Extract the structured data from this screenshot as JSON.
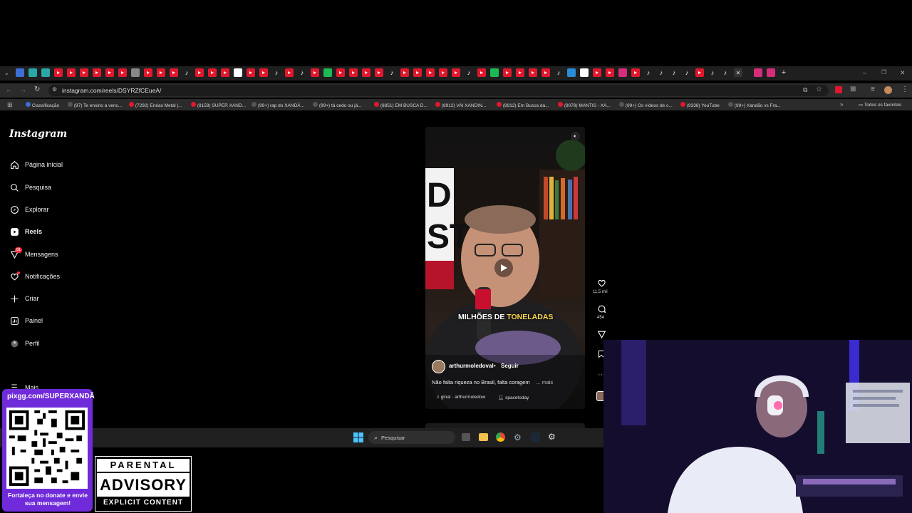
{
  "browser": {
    "url": "instagram.com/reels/DSYRZfCEueA/",
    "bookmarks": [
      {
        "label": "Classificação",
        "color": "#3b6fd6"
      },
      {
        "label": "(97) Te ensino a venc...",
        "color": "#111"
      },
      {
        "label": "(7292) Enéas Metal |...",
        "color": "#e0182d"
      },
      {
        "label": "(8159) SUPER XAND...",
        "color": "#e0182d"
      },
      {
        "label": "(99+) rap do XANDÃ...",
        "color": "#111"
      },
      {
        "label": "(99+) tá cedo ou já...",
        "color": "#111"
      },
      {
        "label": "(8851) EM BUSCA D...",
        "color": "#e0182d"
      },
      {
        "label": "(8912) VAI XANDIN...",
        "color": "#e0182d"
      },
      {
        "label": "(8912) Em Busca da...",
        "color": "#e0182d"
      },
      {
        "label": "(9078) MANTIS - XA...",
        "color": "#e0182d"
      },
      {
        "label": "(99+) Os vídeos de c...",
        "color": "#111"
      },
      {
        "label": "(9338) YouTube",
        "color": "#e0182d"
      },
      {
        "label": "(99+) Xandão vs Fra...",
        "color": "#111"
      }
    ],
    "all_bookmarks_label": "Todos os favoritos"
  },
  "instagram": {
    "logo": "Instagram",
    "nav": [
      {
        "label": "Página inicial",
        "icon": "home-icon"
      },
      {
        "label": "Pesquisa",
        "icon": "search-icon"
      },
      {
        "label": "Explorar",
        "icon": "compass-icon"
      },
      {
        "label": "Reels",
        "icon": "reels-icon"
      },
      {
        "label": "Mensagens",
        "icon": "messenger-icon"
      },
      {
        "label": "Notificações",
        "icon": "heart-icon"
      },
      {
        "label": "Criar",
        "icon": "plus-icon"
      },
      {
        "label": "Painel",
        "icon": "chart-icon"
      },
      {
        "label": "Perfil",
        "icon": "avatar-icon"
      }
    ],
    "messages_badge": "81",
    "more_label": "Mais",
    "reel": {
      "caption_white": "MILHÕES DE ",
      "caption_yellow": "TONELADAS",
      "username": "arthurmoledoval",
      "dot": "•",
      "follow": "Seguir",
      "description": "Não falta riqueza no Brasil, falta coragem",
      "more": "... mais",
      "audio": "ginal · arthurmoledow",
      "tagged": "spacetoday",
      "likes": "11,5 mil",
      "comments": "454"
    }
  },
  "taskbar": {
    "search_placeholder": "Pesquisar"
  },
  "overlay": {
    "donate_url": "pixgg.com/SUPERXANDÃ",
    "donate_message": "Fortaleça no donate e envie sua mensagem!",
    "pa_line1": "PARENTAL",
    "pa_line2": "ADVISORY",
    "pa_line3": "EXPLICIT CONTENT"
  }
}
